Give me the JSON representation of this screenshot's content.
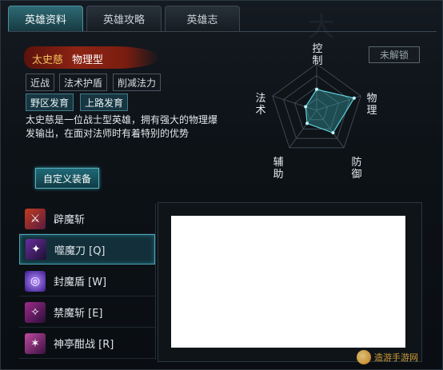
{
  "tabs": [
    {
      "label": "英雄资料",
      "active": true
    },
    {
      "label": "英雄攻略",
      "active": false
    },
    {
      "label": "英雄志",
      "active": false
    }
  ],
  "hero": {
    "name": "太史慈",
    "type": "物理型",
    "tags": [
      "近战",
      "法术护盾",
      "削减法力",
      "野区发育",
      "上路发育"
    ],
    "description": "太史慈是一位战士型英雄，拥有强大的物理爆发输出，在面对法师时有着特别的优势",
    "unlock_status": "未解锁",
    "custom_equip_label": "自定义装备"
  },
  "radar": {
    "axes": [
      "控制",
      "物理",
      "防御",
      "辅助",
      "法术"
    ],
    "values": [
      0.45,
      0.85,
      0.6,
      0.35,
      0.25
    ]
  },
  "skills": [
    {
      "label": "辟魔斩",
      "icon": "sword-icon",
      "selected": false
    },
    {
      "label": "噬魔刀 [Q]",
      "icon": "blade-icon",
      "selected": true
    },
    {
      "label": "封魔盾 [W]",
      "icon": "shield-icon",
      "selected": false
    },
    {
      "label": "禁魔斩 [E]",
      "icon": "slash-icon",
      "selected": false
    },
    {
      "label": "神亭酣战 [R]",
      "icon": "fury-icon",
      "selected": false
    }
  ],
  "colors": {
    "accent": "#4aa7b4",
    "hero_name": "#f3c35a",
    "brush": "#8d2414"
  },
  "watermark": "造游手游网"
}
